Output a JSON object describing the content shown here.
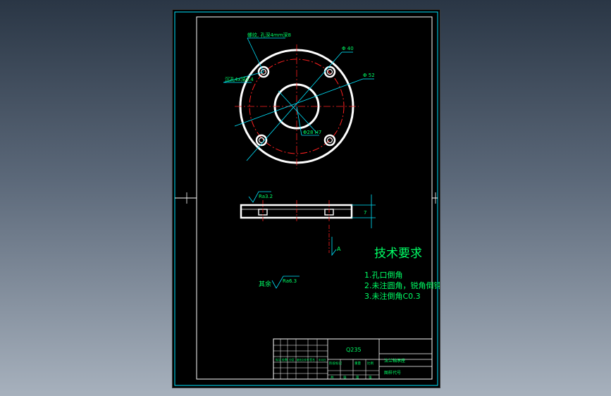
{
  "drawing": {
    "colors": {
      "background": "#000000",
      "outline": "#ffffff",
      "dimension": "#00e5ff",
      "centerline": "#ff2020",
      "annotation": "#00ff66"
    },
    "dimensions": {
      "thread_note": "螺纹, 孔深4mm深8",
      "counterbore_note": "沉孔4x深3.4",
      "dia_inner_circle": "Φ 40",
      "dia_outer": "Φ 52",
      "dia_bore": "Φ28 H7",
      "roughness_side": "Ra3.2",
      "thickness": "7",
      "section_mark": "A"
    },
    "tech_requirements": {
      "title": "技术要求",
      "items": [
        "1.孔口倒角",
        "2.未注圆角，锐角倒钝",
        "3.未注倒角C0.3"
      ]
    },
    "remaining": {
      "label": "其余",
      "roughness": "Ra6.3"
    },
    "title_block": {
      "material": "Q235",
      "part_name": "法兰轴承座",
      "drawing_no": "图样代号",
      "cells_left": [
        "标记",
        "处数",
        "分区",
        "更改文件号",
        "签名",
        "年月日"
      ],
      "cells_mid": [
        "阶段标记",
        "重量",
        "比例"
      ],
      "cells_bottom": [
        "共",
        "张",
        "第",
        "张"
      ]
    }
  }
}
